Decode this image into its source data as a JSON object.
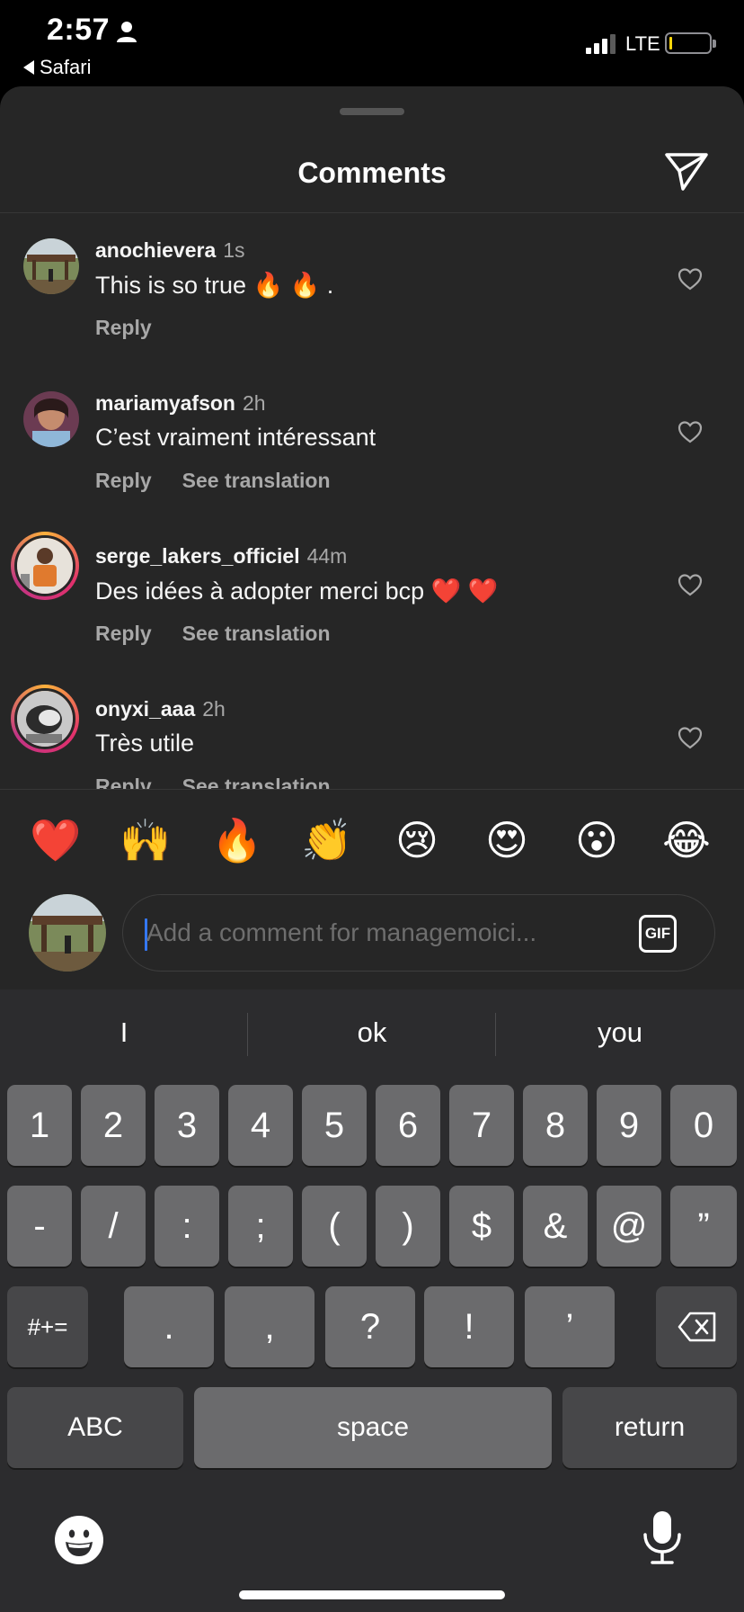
{
  "status_bar": {
    "time": "2:57",
    "back_app": "Safari",
    "network": "LTE",
    "battery_color": "#ffd60a"
  },
  "sheet": {
    "title": "Comments",
    "share_icon": "paper-plane-icon"
  },
  "comments": [
    {
      "username": "anochievera",
      "time": "1s",
      "text": "This is so true 🔥 🔥 .",
      "reply_label": "Reply",
      "translation_label": ""
    },
    {
      "username": "mariamyafson",
      "time": "2h",
      "text": "C’est vraiment intéressant",
      "reply_label": "Reply",
      "translation_label": "See translation"
    },
    {
      "username": "serge_lakers_officiel",
      "time": "44m",
      "text": "Des idées à adopter merci bcp ❤️ ❤️",
      "reply_label": "Reply",
      "translation_label": "See translation"
    },
    {
      "username": "onyxi_aaa",
      "time": "2h",
      "text": "Très utile",
      "reply_label": "Reply",
      "translation_label": "See translation"
    }
  ],
  "quick_reactions": [
    "❤️",
    "🙌",
    "🔥",
    "👏",
    "😢",
    "😍",
    "😮",
    "😂"
  ],
  "composer": {
    "placeholder": "Add a comment for managemoici...",
    "value": "",
    "gif_label": "GIF"
  },
  "keyboard": {
    "suggestions": [
      "I",
      "ok",
      "you"
    ],
    "row1": [
      "1",
      "2",
      "3",
      "4",
      "5",
      "6",
      "7",
      "8",
      "9",
      "0"
    ],
    "row2": [
      "-",
      "/",
      ":",
      ";",
      "(",
      ")",
      "$",
      "&",
      "@",
      "”"
    ],
    "row3_left": "#+=",
    "row3": [
      ".",
      ",",
      "?",
      "!",
      "’"
    ],
    "abc": "ABC",
    "space": "space",
    "return": "return"
  }
}
